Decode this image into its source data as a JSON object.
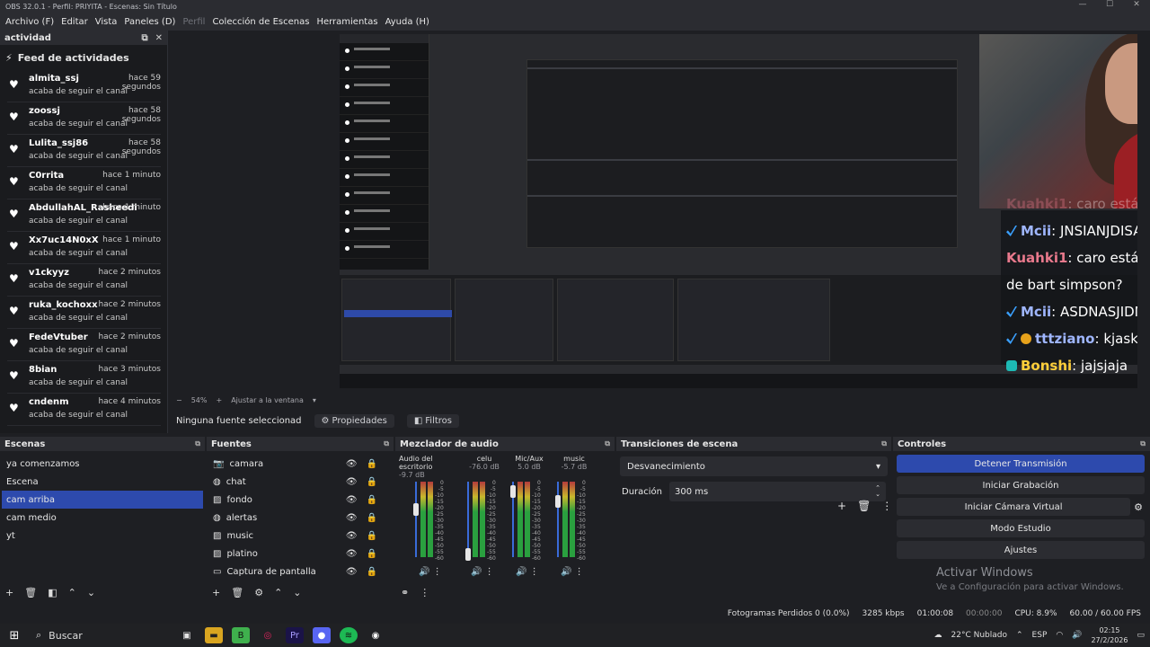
{
  "window": {
    "title": "OBS 32.0.1 - Perfil: PRIYITA - Escenas: Sin Título"
  },
  "menu": [
    "Archivo (F)",
    "Editar",
    "Vista",
    "Paneles (D)",
    "Perfil",
    "Colección de Escenas",
    "Herramientas",
    "Ayuda (H)"
  ],
  "feed": {
    "panel_title": "actividad",
    "title": "Feed de actividades",
    "items": [
      {
        "name": "almita_ssj",
        "time": "hace 59 segundos",
        "action": "acaba de seguir el canal"
      },
      {
        "name": "zoossj",
        "time": "hace 58 segundos",
        "action": "acaba de seguir el canal"
      },
      {
        "name": "Lulita_ssj86",
        "time": "hace 58 segundos",
        "action": "acaba de seguir el canal"
      },
      {
        "name": "C0rrita",
        "time": "hace 1 minuto",
        "action": "acaba de seguir el canal"
      },
      {
        "name": "AbdullahAL_Rasheedi",
        "time": "hace 1 minuto",
        "action": "acaba de seguir el canal"
      },
      {
        "name": "Xx7uc14N0xX",
        "time": "hace 1 minuto",
        "action": "acaba de seguir el canal"
      },
      {
        "name": "v1ckyyz",
        "time": "hace 2 minutos",
        "action": "acaba de seguir el canal"
      },
      {
        "name": "ruka_kochoxx",
        "time": "hace 2 minutos",
        "action": "acaba de seguir el canal"
      },
      {
        "name": "FedeVtuber",
        "time": "hace 2 minutos",
        "action": "acaba de seguir el canal"
      },
      {
        "name": "8bian",
        "time": "hace 3 minutos",
        "action": "acaba de seguir el canal"
      },
      {
        "name": "cndenm",
        "time": "hace 4 minutos",
        "action": "acaba de seguir el canal"
      }
    ]
  },
  "chat": [
    {
      "user": "Kuahki1",
      "text": "caro estás haciendo cosplay",
      "color": "#e8798c",
      "badge": "none"
    },
    {
      "user": "Mcii",
      "text": "JNSIANJDISADISAJNI",
      "color": "#9fb6ff",
      "badge": "blue"
    },
    {
      "user": "Kuahki1",
      "text": "caro estás haciendo cosplay",
      "color": "#e8798c",
      "badge": "none"
    },
    {
      "user": "",
      "text": "de bart simpson?",
      "color": "#e8798c",
      "badge": "none"
    },
    {
      "user": "Mcii",
      "text": "ASDNASJIDNJSAIDNJIAINJD",
      "color": "#9fb6ff",
      "badge": "blue"
    },
    {
      "user": "tttziano",
      "text": "kjasklfjklJKLASJFKLASJF",
      "color": "#9fb6ff",
      "badge": "gold"
    },
    {
      "user": "Bonshi",
      "text": "jajsjaja",
      "color": "#ffcf3a",
      "badge": "teal"
    }
  ],
  "preview": {
    "zoom": "54%",
    "fit": "Ajustar a la ventana"
  },
  "source_bar": {
    "no_source": "Ninguna fuente seleccionad",
    "properties": "Propiedades",
    "filters": "Filtros"
  },
  "scenes": {
    "title": "Escenas",
    "items": [
      "ya comenzamos",
      "Escena",
      "cam arriba",
      "cam  medio",
      "yt"
    ],
    "selected": 2
  },
  "sources": {
    "title": "Fuentes",
    "items": [
      {
        "name": "camara",
        "icon": "camera-icon"
      },
      {
        "name": "chat",
        "icon": "browser-icon"
      },
      {
        "name": "fondo",
        "icon": "image-icon"
      },
      {
        "name": "alertas",
        "icon": "browser-icon"
      },
      {
        "name": "music",
        "icon": "image-icon"
      },
      {
        "name": "platino",
        "icon": "image-icon"
      },
      {
        "name": "Captura de pantalla",
        "icon": "monitor-icon"
      }
    ]
  },
  "mixer": {
    "title": "Mezclador de audio",
    "channels": [
      {
        "name": "Audio del escritorio",
        "db": "-9.7 dB",
        "level": 0.72
      },
      {
        "name": "celu",
        "db": "-76.0 dB",
        "level": 0.12
      },
      {
        "name": "Mic/Aux",
        "db": "5.0 dB",
        "level": 0.95
      },
      {
        "name": "music",
        "db": "-5.7 dB",
        "level": 0.82
      }
    ],
    "scale": [
      "0",
      "-5",
      "-10",
      "-15",
      "-20",
      "-25",
      "-30",
      "-35",
      "-40",
      "-45",
      "-50",
      "-55",
      "-60"
    ]
  },
  "transitions": {
    "title": "Transiciones de escena",
    "selected": "Desvanecimiento",
    "duration_label": "Duración",
    "duration": "300 ms"
  },
  "controls": {
    "title": "Controles",
    "buttons": [
      "Detener Transmisión",
      "Iniciar Grabación",
      "Iniciar Cámara Virtual",
      "Modo Estudio",
      "Ajustes"
    ],
    "activate": "Activar Windows",
    "activate_hint": "Ve a Configuración para activar Windows."
  },
  "status": {
    "frames": "Fotogramas Perdidos 0 (0.0%)",
    "bitrate": "3285 kbps",
    "live": "01:00:08",
    "rec": "00:00:00",
    "cpu": "CPU: 8.9%",
    "fps": "60.00 / 60.00 FPS"
  },
  "taskbar": {
    "search": "Buscar",
    "weather": "22°C  Nublado",
    "lang": "ESP",
    "time": "02:15",
    "date": "27/2/2026"
  }
}
